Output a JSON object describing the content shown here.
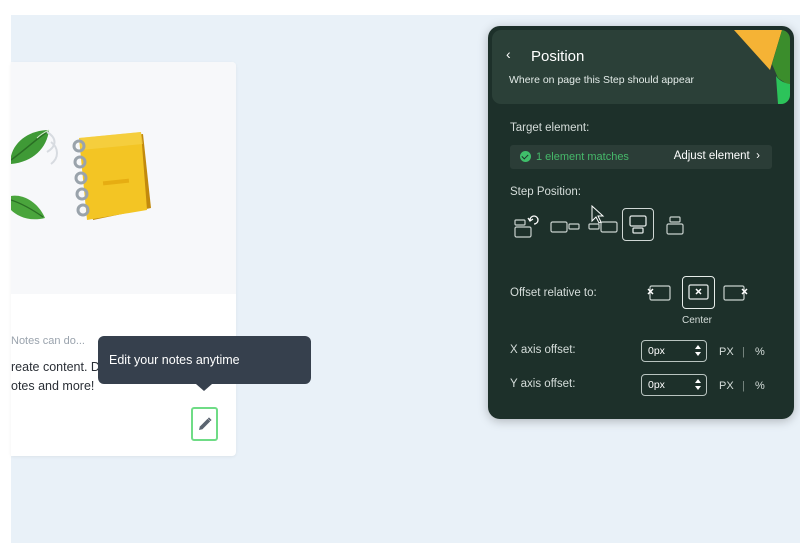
{
  "card": {
    "subtitle": "Notes can do...",
    "text_line1": "reate content. Dr",
    "text_line2": "otes and more!"
  },
  "tooltip": {
    "text": "Edit your notes anytime"
  },
  "panel": {
    "title": "Position",
    "subtitle": "Where on page this Step should appear",
    "target_label": "Target element:",
    "match_text": "1 element matches",
    "adjust_label": "Adjust element",
    "step_position_label": "Step Position:",
    "offset_label": "Offset relative to:",
    "center_label": "Center",
    "x_label": "X axis offset:",
    "y_label": "Y axis offset:",
    "x_value": "0px",
    "y_value": "0px",
    "unit_px": "PX",
    "unit_pct": "%"
  },
  "colors": {
    "panel_bg": "#1d302a",
    "accent_green": "#3fbf6a",
    "tooltip_bg": "#36404d",
    "edit_border": "#6fdc86"
  }
}
